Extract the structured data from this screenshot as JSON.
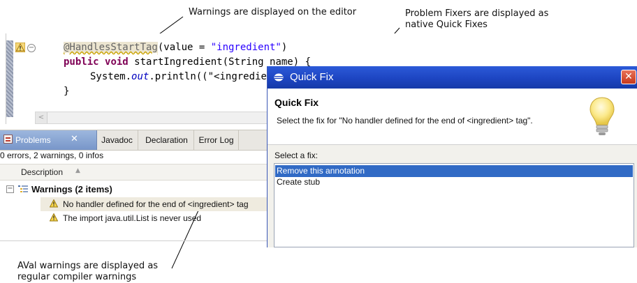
{
  "annotations": {
    "editor_warnings": "Warnings are displayed on the editor",
    "fixers_line1": "Problem Fixers are displayed as",
    "fixers_line2": "native Quick Fixes",
    "aval_line1": "AVal warnings are displayed as",
    "aval_line2": "regular compiler warnings"
  },
  "editor": {
    "line1_annotation": "@HandlesStartTag",
    "line1_rest_open": "(value = ",
    "line1_string": "\"ingredient\"",
    "line1_close": ")",
    "line2_kw1": "public",
    "line2_kw2": "void",
    "line2_rest": " startIngredient(String name) {",
    "line3_prefix": "System.",
    "line3_field": "out",
    "line3_rest": ".println((\"<ingredient",
    "line4": "}"
  },
  "problems": {
    "tabs": [
      "Problems",
      "Javadoc",
      "Declaration",
      "Error Log"
    ],
    "close_glyph": "✕",
    "summary": "0 errors, 2 warnings, 0 infos",
    "column_header": "Description",
    "group_label": "Warnings (2 items)",
    "items": [
      "No handler defined for the end of <ingredient> tag",
      "The import java.util.List is never used"
    ]
  },
  "quickfix": {
    "title": "Quick Fix",
    "heading": "Quick Fix",
    "description": "Select the fix for \"No handler defined for the end of <ingredient> tag\".",
    "select_label": "Select a fix:",
    "fixes": [
      "Remove this annotation",
      "Create stub"
    ],
    "close_glyph": "✕"
  },
  "colors": {
    "title_bar": "#1d45c2",
    "selection": "#316ac5",
    "keyword": "#7f0055",
    "string": "#2a00ff"
  }
}
